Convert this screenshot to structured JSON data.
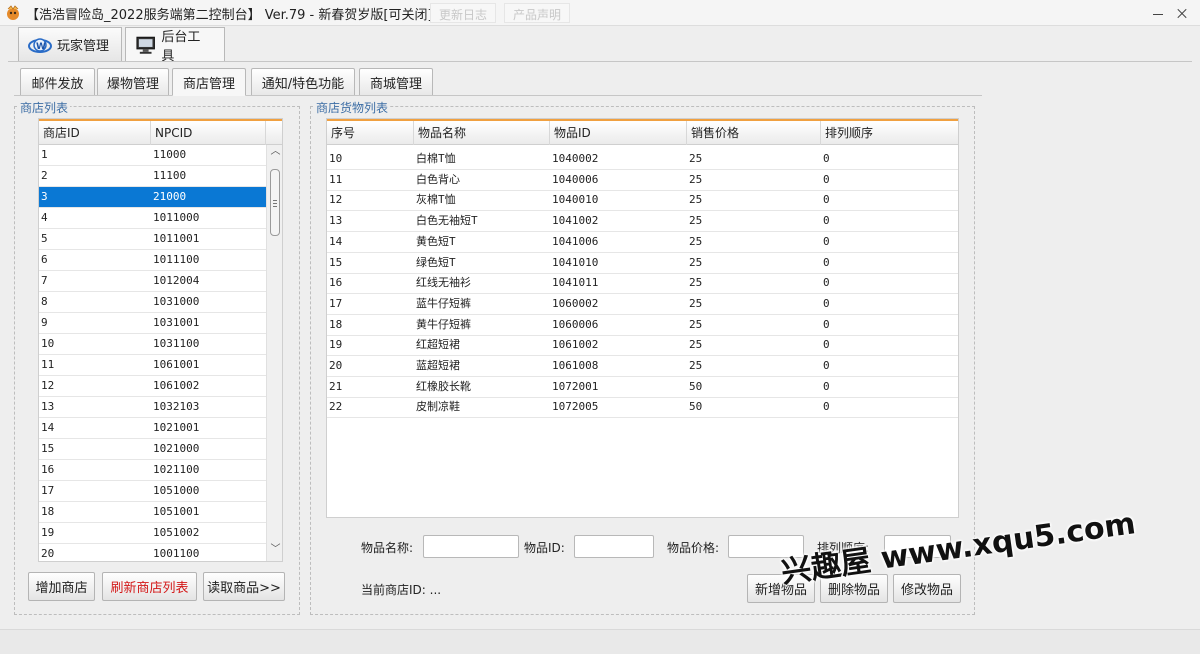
{
  "window": {
    "title": "【浩浩冒险岛_2022服务端第二控制台】 Ver.79 - 新春贺岁版[可关闭]",
    "ghost_tabs": [
      "更新日志",
      "产品声明"
    ]
  },
  "main_tabs": [
    {
      "label": "玩家管理",
      "icon": "player-icon",
      "active": false
    },
    {
      "label": "后台工具",
      "icon": "monitor-icon",
      "active": true
    }
  ],
  "sub_tabs": [
    {
      "label": "邮件发放",
      "active": false
    },
    {
      "label": "爆物管理",
      "active": false
    },
    {
      "label": "商店管理",
      "active": true
    },
    {
      "label": "通知/特色功能",
      "active": false
    },
    {
      "label": "商城管理",
      "active": false
    }
  ],
  "shop_list": {
    "title": "商店列表",
    "columns": [
      "商店ID",
      "NPCID"
    ],
    "selected_index": 2,
    "rows": [
      [
        "1",
        "11000"
      ],
      [
        "2",
        "11100"
      ],
      [
        "3",
        "21000"
      ],
      [
        "4",
        "1011000"
      ],
      [
        "5",
        "1011001"
      ],
      [
        "6",
        "1011100"
      ],
      [
        "7",
        "1012004"
      ],
      [
        "8",
        "1031000"
      ],
      [
        "9",
        "1031001"
      ],
      [
        "10",
        "1031100"
      ],
      [
        "11",
        "1061001"
      ],
      [
        "12",
        "1061002"
      ],
      [
        "13",
        "1032103"
      ],
      [
        "14",
        "1021001"
      ],
      [
        "15",
        "1021000"
      ],
      [
        "16",
        "1021100"
      ],
      [
        "17",
        "1051000"
      ],
      [
        "18",
        "1051001"
      ],
      [
        "19",
        "1051002"
      ],
      [
        "20",
        "1001100"
      ]
    ],
    "buttons": {
      "add": "增加商店",
      "refresh": "刷新商店列表",
      "read": "读取商品>>"
    }
  },
  "goods_list": {
    "title": "商店货物列表",
    "columns": [
      "序号",
      "物品名称",
      "物品ID",
      "销售价格",
      "排列顺序"
    ],
    "rows": [
      [
        "10",
        "白棉T恤",
        "1040002",
        "25",
        "0"
      ],
      [
        "11",
        "白色背心",
        "1040006",
        "25",
        "0"
      ],
      [
        "12",
        "灰棉T恤",
        "1040010",
        "25",
        "0"
      ],
      [
        "13",
        "白色无袖短T",
        "1041002",
        "25",
        "0"
      ],
      [
        "14",
        "黄色短T",
        "1041006",
        "25",
        "0"
      ],
      [
        "15",
        "绿色短T",
        "1041010",
        "25",
        "0"
      ],
      [
        "16",
        "红线无袖衫",
        "1041011",
        "25",
        "0"
      ],
      [
        "17",
        "蓝牛仔短裤",
        "1060002",
        "25",
        "0"
      ],
      [
        "18",
        "黄牛仔短裤",
        "1060006",
        "25",
        "0"
      ],
      [
        "19",
        "红超短裙",
        "1061002",
        "25",
        "0"
      ],
      [
        "20",
        "蓝超短裙",
        "1061008",
        "25",
        "0"
      ],
      [
        "21",
        "红橡胶长靴",
        "1072001",
        "50",
        "0"
      ],
      [
        "22",
        "皮制凉鞋",
        "1072005",
        "50",
        "0"
      ]
    ]
  },
  "form": {
    "name_label": "物品名称:",
    "id_label": "物品ID:",
    "price_label": "物品价格:",
    "order_label": "排列顺序:",
    "name_value": "",
    "id_value": "",
    "price_value": "",
    "order_value": ""
  },
  "status": {
    "current_shop": "当前商店ID: ..."
  },
  "actions": {
    "add_item": "新增物品",
    "delete_item": "删除物品",
    "modify_item": "修改物品"
  },
  "watermark": "兴趣屋 www.xqu5.com"
}
